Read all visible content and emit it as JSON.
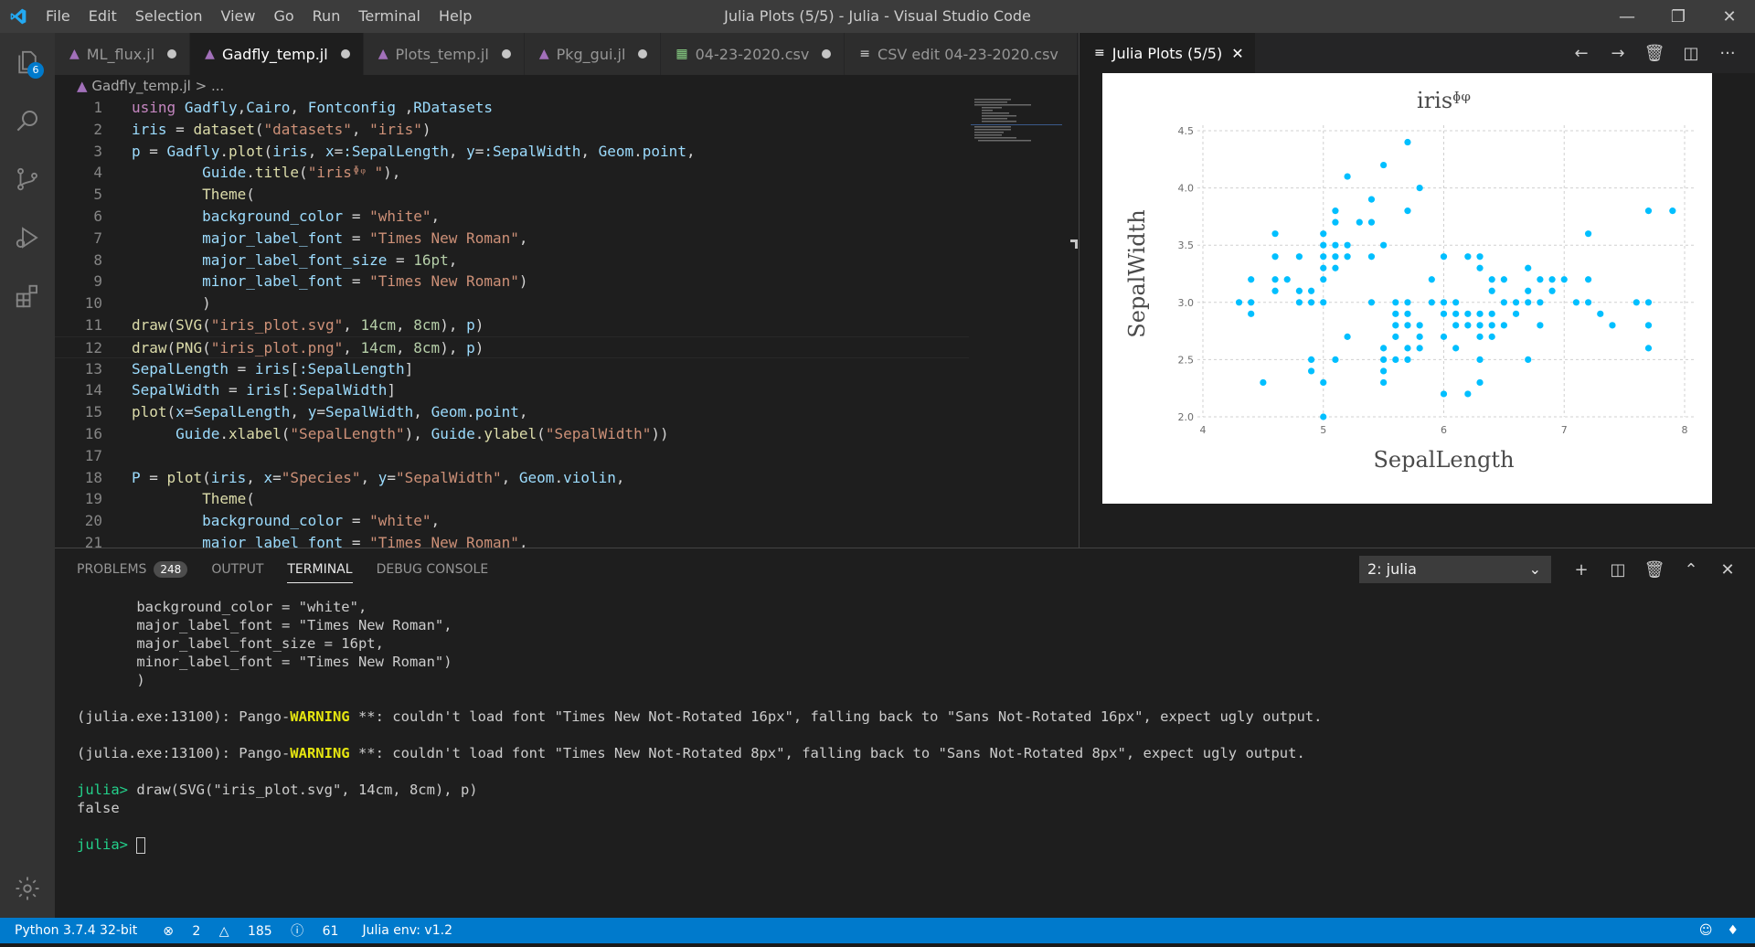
{
  "window": {
    "title": "Julia Plots (5/5) - Julia - Visual Studio Code",
    "menu": [
      "File",
      "Edit",
      "Selection",
      "View",
      "Go",
      "Run",
      "Terminal",
      "Help"
    ]
  },
  "activity_bar": {
    "explorer_badge": "6"
  },
  "editor": {
    "tabs": [
      {
        "label": "ML_flux.jl",
        "icon": "julia-icon"
      },
      {
        "label": "Gadfly_temp.jl",
        "icon": "julia-icon",
        "active": true
      },
      {
        "label": "Plots_temp.jl",
        "icon": "julia-icon"
      },
      {
        "label": "Pkg_gui.jl",
        "icon": "julia-icon"
      },
      {
        "label": "04-23-2020.csv",
        "icon": "csv-icon"
      },
      {
        "label": "CSV edit 04-23-2020.csv",
        "icon": "preview-icon"
      }
    ],
    "more": "···",
    "breadcrumb": {
      "file": "Gadfly_temp.jl",
      "sep": ">",
      "rest": "..."
    },
    "lines": [
      {
        "n": "1",
        "code": "using Gadfly,Cairo, Fontconfig ,RDatasets"
      },
      {
        "n": "2",
        "code": "iris = dataset(\"datasets\", \"iris\")"
      },
      {
        "n": "3",
        "code": "p = Gadfly.plot(iris, x=:SepalLength, y=:SepalWidth, Geom.point,"
      },
      {
        "n": "4",
        "code": "        Guide.title(\"irisᶲᵠ \"),"
      },
      {
        "n": "5",
        "code": "        Theme("
      },
      {
        "n": "6",
        "code": "        background_color = \"white\","
      },
      {
        "n": "7",
        "code": "        major_label_font = \"Times New Roman\","
      },
      {
        "n": "8",
        "code": "        major_label_font_size = 16pt,"
      },
      {
        "n": "9",
        "code": "        minor_label_font = \"Times New Roman\")"
      },
      {
        "n": "10",
        "code": "        )"
      },
      {
        "n": "11",
        "code": "draw(SVG(\"iris_plot.svg\", 14cm, 8cm), p)"
      },
      {
        "n": "12",
        "code": "draw(PNG(\"iris_plot.png\", 14cm, 8cm), p)"
      },
      {
        "n": "13",
        "code": "SepalLength = iris[:SepalLength]"
      },
      {
        "n": "14",
        "code": "SepalWidth = iris[:SepalWidth]"
      },
      {
        "n": "15",
        "code": "plot(x=SepalLength, y=SepalWidth, Geom.point,"
      },
      {
        "n": "16",
        "code": "     Guide.xlabel(\"SepalLength\"), Guide.ylabel(\"SepalWidth\"))"
      },
      {
        "n": "17",
        "code": ""
      },
      {
        "n": "18",
        "code": "P = plot(iris, x=\"Species\", y=\"SepalWidth\", Geom.violin,"
      },
      {
        "n": "19",
        "code": "        Theme("
      },
      {
        "n": "20",
        "code": "        background_color = \"white\","
      },
      {
        "n": "21",
        "code": "        major_label_font = \"Times New Roman\","
      }
    ]
  },
  "plot_pane": {
    "tab_label": "Julia Plots (5/5)",
    "chart_data": {
      "type": "scatter",
      "title": "irisᶲᵠ",
      "xlabel": "SepalLength",
      "ylabel": "SepalWidth",
      "xlim": [
        4,
        8
      ],
      "ylim": [
        2.0,
        4.5
      ],
      "xticks": [
        "4",
        "5",
        "6",
        "7",
        "8"
      ],
      "yticks": [
        "2.0",
        "2.5",
        "3.0",
        "3.5",
        "4.0",
        "4.5"
      ],
      "grid": true,
      "color": "#00bfff",
      "points": [
        [
          4.3,
          3.0
        ],
        [
          4.4,
          3.0
        ],
        [
          4.4,
          3.2
        ],
        [
          4.4,
          2.9
        ],
        [
          4.5,
          2.3
        ],
        [
          4.6,
          3.1
        ],
        [
          4.6,
          3.4
        ],
        [
          4.6,
          3.6
        ],
        [
          4.6,
          3.2
        ],
        [
          4.7,
          3.2
        ],
        [
          4.8,
          3.4
        ],
        [
          4.8,
          3.0
        ],
        [
          4.8,
          3.1
        ],
        [
          4.9,
          3.0
        ],
        [
          4.9,
          3.1
        ],
        [
          4.9,
          2.5
        ],
        [
          4.9,
          2.4
        ],
        [
          5.0,
          3.6
        ],
        [
          5.0,
          3.4
        ],
        [
          5.0,
          3.0
        ],
        [
          5.0,
          3.2
        ],
        [
          5.0,
          3.5
        ],
        [
          5.0,
          3.3
        ],
        [
          5.0,
          2.0
        ],
        [
          5.0,
          2.3
        ],
        [
          5.1,
          3.5
        ],
        [
          5.1,
          3.8
        ],
        [
          5.1,
          3.7
        ],
        [
          5.1,
          3.3
        ],
        [
          5.1,
          3.4
        ],
        [
          5.1,
          2.5
        ],
        [
          5.2,
          3.5
        ],
        [
          5.2,
          3.4
        ],
        [
          5.2,
          4.1
        ],
        [
          5.2,
          2.7
        ],
        [
          5.3,
          3.7
        ],
        [
          5.4,
          3.9
        ],
        [
          5.4,
          3.7
        ],
        [
          5.4,
          3.4
        ],
        [
          5.4,
          3.0
        ],
        [
          5.5,
          4.2
        ],
        [
          5.5,
          3.5
        ],
        [
          5.5,
          2.3
        ],
        [
          5.5,
          2.4
        ],
        [
          5.5,
          2.6
        ],
        [
          5.5,
          2.5
        ],
        [
          5.6,
          2.9
        ],
        [
          5.6,
          3.0
        ],
        [
          5.6,
          2.5
        ],
        [
          5.6,
          2.7
        ],
        [
          5.6,
          2.8
        ],
        [
          5.7,
          4.4
        ],
        [
          5.7,
          3.8
        ],
        [
          5.7,
          2.8
        ],
        [
          5.7,
          2.6
        ],
        [
          5.7,
          3.0
        ],
        [
          5.7,
          2.9
        ],
        [
          5.7,
          2.5
        ],
        [
          5.8,
          4.0
        ],
        [
          5.8,
          2.7
        ],
        [
          5.8,
          2.6
        ],
        [
          5.8,
          2.8
        ],
        [
          5.9,
          3.0
        ],
        [
          5.9,
          3.2
        ],
        [
          6.0,
          2.2
        ],
        [
          6.0,
          2.9
        ],
        [
          6.0,
          3.4
        ],
        [
          6.0,
          2.7
        ],
        [
          6.0,
          3.0
        ],
        [
          6.1,
          2.9
        ],
        [
          6.1,
          2.8
        ],
        [
          6.1,
          3.0
        ],
        [
          6.1,
          2.6
        ],
        [
          6.2,
          2.2
        ],
        [
          6.2,
          2.9
        ],
        [
          6.2,
          3.4
        ],
        [
          6.2,
          2.8
        ],
        [
          6.3,
          3.3
        ],
        [
          6.3,
          2.5
        ],
        [
          6.3,
          2.3
        ],
        [
          6.3,
          2.7
        ],
        [
          6.3,
          2.9
        ],
        [
          6.3,
          2.8
        ],
        [
          6.3,
          3.4
        ],
        [
          6.4,
          3.2
        ],
        [
          6.4,
          2.9
        ],
        [
          6.4,
          2.7
        ],
        [
          6.4,
          2.8
        ],
        [
          6.4,
          3.1
        ],
        [
          6.5,
          2.8
        ],
        [
          6.5,
          3.0
        ],
        [
          6.5,
          3.2
        ],
        [
          6.6,
          2.9
        ],
        [
          6.6,
          3.0
        ],
        [
          6.7,
          3.1
        ],
        [
          6.7,
          3.0
        ],
        [
          6.7,
          2.5
        ],
        [
          6.7,
          3.3
        ],
        [
          6.8,
          2.8
        ],
        [
          6.8,
          3.0
        ],
        [
          6.8,
          3.2
        ],
        [
          6.9,
          3.1
        ],
        [
          6.9,
          3.2
        ],
        [
          7.0,
          3.2
        ],
        [
          7.1,
          3.0
        ],
        [
          7.2,
          3.6
        ],
        [
          7.2,
          3.2
        ],
        [
          7.2,
          3.0
        ],
        [
          7.3,
          2.9
        ],
        [
          7.4,
          2.8
        ],
        [
          7.6,
          3.0
        ],
        [
          7.7,
          3.8
        ],
        [
          7.7,
          2.6
        ],
        [
          7.7,
          2.8
        ],
        [
          7.7,
          3.0
        ],
        [
          7.9,
          3.8
        ]
      ]
    }
  },
  "panel": {
    "tabs": [
      {
        "label": "PROBLEMS",
        "count": "248"
      },
      {
        "label": "OUTPUT"
      },
      {
        "label": "TERMINAL",
        "active": true
      },
      {
        "label": "DEBUG CONSOLE"
      }
    ],
    "terminal_select": "2: julia",
    "terminal_lines": [
      "       background_color = \"white\",",
      "       major_label_font = \"Times New Roman\",",
      "       major_label_font_size = 16pt,",
      "       minor_label_font = \"Times New Roman\")",
      "       )",
      "",
      "(julia.exe:13100): Pango-|WARNING| **: couldn't load font \"Times New Not-Rotated 16px\", falling back to \"Sans Not-Rotated 16px\", expect ugly output.",
      "",
      "(julia.exe:13100): Pango-|WARNING| **: couldn't load font \"Times New Not-Rotated 8px\", falling back to \"Sans Not-Rotated 8px\", expect ugly output.",
      "",
      "julia> draw(SVG(\"iris_plot.svg\", 14cm, 8cm), p)",
      "false",
      ""
    ],
    "prompt": "julia> "
  },
  "status_bar": {
    "python": "Python 3.7.4 32-bit",
    "errors": "2",
    "warnings": "185",
    "infos": "61",
    "julia_env": "Julia env: v1.2"
  }
}
